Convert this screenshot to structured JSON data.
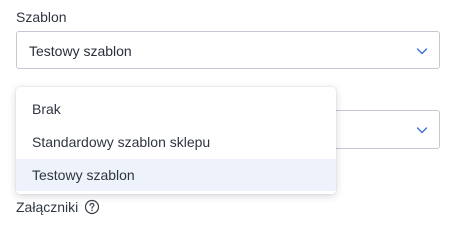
{
  "template_field": {
    "label": "Szablon",
    "selected_value": "Testowy szablon",
    "options": [
      {
        "label": "Brak",
        "selected": false
      },
      {
        "label": "Standardowy szablon sklepu",
        "selected": false
      },
      {
        "label": "Testowy szablon",
        "selected": true
      }
    ]
  },
  "attachments": {
    "label": "Załączniki",
    "help_icon": "question-circle-icon"
  },
  "icons": {
    "chevron": "chevron-down-icon"
  },
  "colors": {
    "text": "#2f3541",
    "border": "#c3c8d3",
    "chevron": "#3d6fd1",
    "highlight": "#eef2fb"
  }
}
